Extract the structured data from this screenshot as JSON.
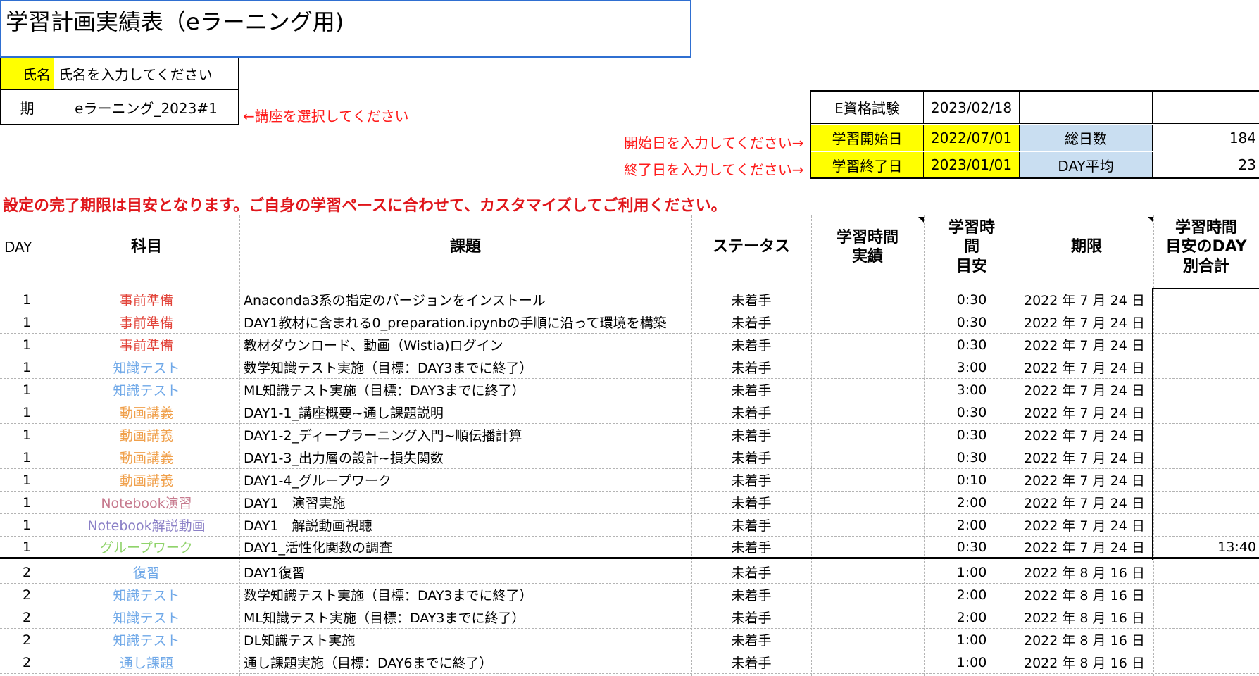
{
  "title": "学習計画実績表（eラーニング用)",
  "name_label": "氏名",
  "name_value": "氏名を入力してください",
  "term_label": "期",
  "term_value": "eラーニング_2023#1",
  "term_note": "←講座を選択してください",
  "exam_label": "E資格試験",
  "exam_date": "2023/02/18",
  "start_note": "開始日を入力してください→",
  "start_label": "学習開始日",
  "start_date": "2022/07/01",
  "total_days_label": "総日数",
  "total_days": "184",
  "end_note": "終了日を入力してください→",
  "end_label": "学習終了日",
  "end_date": "2023/01/01",
  "day_avg_label": "DAY平均",
  "day_avg": "23",
  "banner": "設定の完了期限は目安となります。ご自身の学習ペースに合わせて、カスタマイズしてご利用ください。",
  "headers": {
    "day": "DAY",
    "subject": "科目",
    "task": "課題",
    "status": "ステータス",
    "actual_line1": "学習時間",
    "actual_line2": "実績",
    "target_line1": "学習時",
    "target_line2": "間",
    "target_line3": "目安",
    "deadline": "期限",
    "total_line1": "学習時間",
    "total_line2": "目安のDAY",
    "total_line3": "別合計"
  },
  "colors": {
    "事前準備": "#e2443a",
    "知識テスト": "#6fa8e8",
    "動画講義": "#f0a04b",
    "Notebook演習": "#c77b8f",
    "Notebook解説動画": "#8a7fc6",
    "グループワーク": "#8fd36a",
    "復習": "#6fa8e8",
    "通し課題": "#6fa8e8"
  },
  "rows": [
    {
      "day": "1",
      "subject": "事前準備",
      "task": "Anaconda3系の指定のバージョンをインストール",
      "status": "未着手",
      "actual": "",
      "target": "0:30",
      "deadline": "2022 年 7 月 24 日",
      "total": ""
    },
    {
      "day": "1",
      "subject": "事前準備",
      "task": "DAY1教材に含まれる0_preparation.ipynbの手順に沿って環境を構築",
      "status": "未着手",
      "actual": "",
      "target": "0:30",
      "deadline": "2022 年 7 月 24 日",
      "total": ""
    },
    {
      "day": "1",
      "subject": "事前準備",
      "task": "教材ダウンロード、動画（Wistia)ログイン",
      "status": "未着手",
      "actual": "",
      "target": "0:30",
      "deadline": "2022 年 7 月 24 日",
      "total": ""
    },
    {
      "day": "1",
      "subject": "知識テスト",
      "task": "数学知識テスト実施（目標：DAY3までに終了）",
      "status": "未着手",
      "actual": "",
      "target": "3:00",
      "deadline": "2022 年 7 月 24 日",
      "total": ""
    },
    {
      "day": "1",
      "subject": "知識テスト",
      "task": "ML知識テスト実施（目標：DAY3までに終了）",
      "status": "未着手",
      "actual": "",
      "target": "3:00",
      "deadline": "2022 年 7 月 24 日",
      "total": ""
    },
    {
      "day": "1",
      "subject": "動画講義",
      "task": "DAY1-1_講座概要~通し課題説明",
      "status": "未着手",
      "actual": "",
      "target": "0:30",
      "deadline": "2022 年 7 月 24 日",
      "total": ""
    },
    {
      "day": "1",
      "subject": "動画講義",
      "task": "DAY1-2_ディープラーニング入門~順伝播計算",
      "status": "未着手",
      "actual": "",
      "target": "0:30",
      "deadline": "2022 年 7 月 24 日",
      "total": ""
    },
    {
      "day": "1",
      "subject": "動画講義",
      "task": "DAY1-3_出力層の設計~損失関数",
      "status": "未着手",
      "actual": "",
      "target": "0:30",
      "deadline": "2022 年 7 月 24 日",
      "total": ""
    },
    {
      "day": "1",
      "subject": "動画講義",
      "task": "DAY1-4_グループワーク",
      "status": "未着手",
      "actual": "",
      "target": "0:10",
      "deadline": "2022 年 7 月 24 日",
      "total": ""
    },
    {
      "day": "1",
      "subject": "Notebook演習",
      "task": "DAY1　演習実施",
      "status": "未着手",
      "actual": "",
      "target": "2:00",
      "deadline": "2022 年 7 月 24 日",
      "total": ""
    },
    {
      "day": "1",
      "subject": "Notebook解説動画",
      "task": "DAY1　解説動画視聴",
      "status": "未着手",
      "actual": "",
      "target": "2:00",
      "deadline": "2022 年 7 月 24 日",
      "total": ""
    },
    {
      "day": "1",
      "subject": "グループワーク",
      "task": "DAY1_活性化関数の調査",
      "status": "未着手",
      "actual": "",
      "target": "0:30",
      "deadline": "2022 年 7 月 24 日",
      "total": "13:40"
    },
    {
      "day": "2",
      "subject": "復習",
      "task": "DAY1復習",
      "status": "未着手",
      "actual": "",
      "target": "1:00",
      "deadline": "2022 年 8 月 16 日",
      "total": ""
    },
    {
      "day": "2",
      "subject": "知識テスト",
      "task": "数学知識テスト実施（目標：DAY3までに終了）",
      "status": "未着手",
      "actual": "",
      "target": "2:00",
      "deadline": "2022 年 8 月 16 日",
      "total": ""
    },
    {
      "day": "2",
      "subject": "知識テスト",
      "task": "ML知識テスト実施（目標：DAY3までに終了）",
      "status": "未着手",
      "actual": "",
      "target": "2:00",
      "deadline": "2022 年 8 月 16 日",
      "total": ""
    },
    {
      "day": "2",
      "subject": "知識テスト",
      "task": "DL知識テスト実施",
      "status": "未着手",
      "actual": "",
      "target": "1:00",
      "deadline": "2022 年 8 月 16 日",
      "total": ""
    },
    {
      "day": "2",
      "subject": "通し課題",
      "task": "通し課題実施（目標：DAY6までに終了）",
      "status": "未着手",
      "actual": "",
      "target": "1:00",
      "deadline": "2022 年 8 月 16 日",
      "total": ""
    }
  ]
}
